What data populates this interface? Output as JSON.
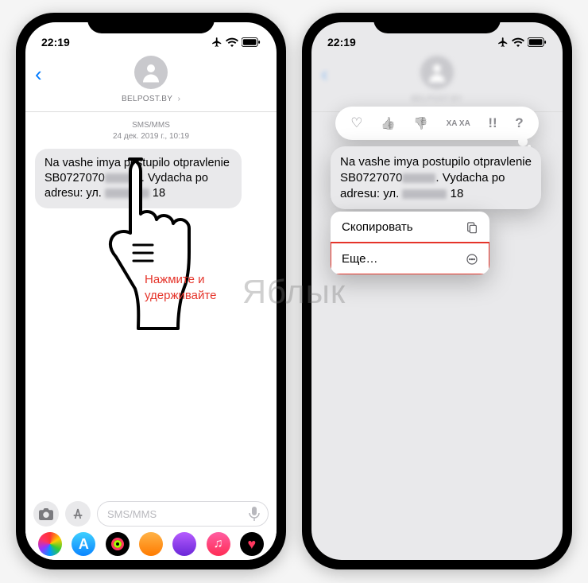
{
  "status": {
    "time": "22:19"
  },
  "header": {
    "sender": "BELPOST.BY"
  },
  "thread": {
    "channel": "SMS/MMS",
    "timestamp": "24 дек. 2019 г., 10:19",
    "message_line1": "Na vashe imya postupilo otpravlenie",
    "message_tracking_prefix": "SB0727070",
    "message_after_tracking": ". Vydacha po",
    "message_line3_prefix": "adresu: ул.",
    "message_line3_suffix": "18"
  },
  "hint": {
    "line1": "Нажмите и",
    "line2": "удерживайте"
  },
  "compose": {
    "placeholder": "SMS/MMS"
  },
  "reactions": {
    "heart": "♡",
    "thumbs_up": "👍",
    "thumbs_down": "👎",
    "haha": "XA XA",
    "exclaim": "!!",
    "question": "?"
  },
  "context_menu": {
    "copy": "Скопировать",
    "more": "Еще…"
  },
  "watermark": "Яблык",
  "colors": {
    "highlight": "#e5342a",
    "ios_blue": "#007aff",
    "bubble": "#e9e9eb"
  }
}
